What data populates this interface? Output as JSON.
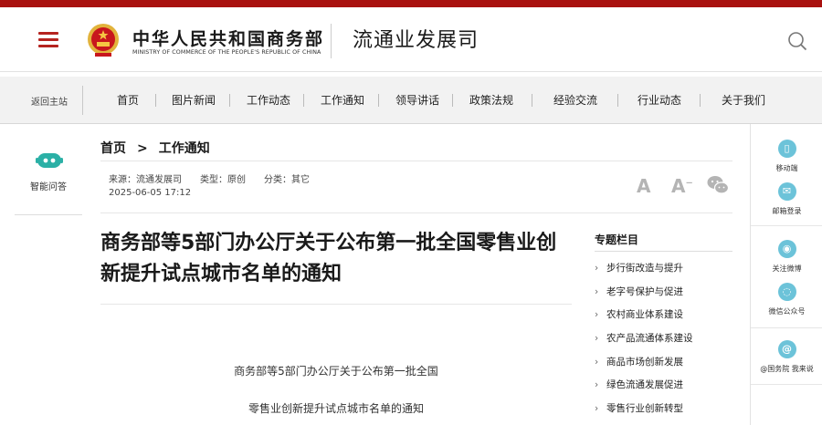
{
  "header": {
    "ministry_cn": "中华人民共和国商务部",
    "ministry_en": "MINISTRY OF COMMERCE OF THE PEOPLE'S REPUBLIC OF CHINA",
    "dept_name": "流通业发展司",
    "brand_color": "#a9110f"
  },
  "nav": {
    "back": "返回主站",
    "items": [
      "首页",
      "图片新闻",
      "工作动态",
      "工作通知",
      "领导讲话",
      "政策法规",
      "经验交流",
      "行业动态",
      "关于我们"
    ]
  },
  "left_panel": {
    "label": "智能问答"
  },
  "breadcrumb": {
    "home": "首页",
    "arrow": ">",
    "current": "工作通知"
  },
  "meta": {
    "source": "来源：流通发展司",
    "type": "类型：原创",
    "category": "分类：其它",
    "date": "2025-06-05 17:12"
  },
  "tools": {
    "font_large": "A",
    "font_small": "A",
    "font_small_mark": "−"
  },
  "article": {
    "title": "商务部等5部门办公厅关于公布第一批全国零售业创新提升试点城市名单的通知",
    "body": [
      "商务部等5部门办公厅关于公布第一批全国",
      "零售业创新提升试点城市名单的通知"
    ]
  },
  "topics": {
    "heading": "专题栏目",
    "items": [
      "步行街改造与提升",
      "老字号保护与促进",
      "农村商业体系建设",
      "农产品流通体系建设",
      "商品市场创新发展",
      "绿色流通发展促进",
      "零售行业创新转型"
    ]
  },
  "right_bar": {
    "items": [
      {
        "label": "移动端",
        "icon": "mobile-icon"
      },
      {
        "label": "邮箱登录",
        "icon": "mail-icon"
      },
      {
        "label": "关注微博",
        "icon": "weibo-icon"
      },
      {
        "label": "微信公众号",
        "icon": "wechat-icon"
      },
      {
        "label": "@国务院 我来说",
        "icon": "at-icon"
      }
    ],
    "accent": "#6cc3d9"
  }
}
